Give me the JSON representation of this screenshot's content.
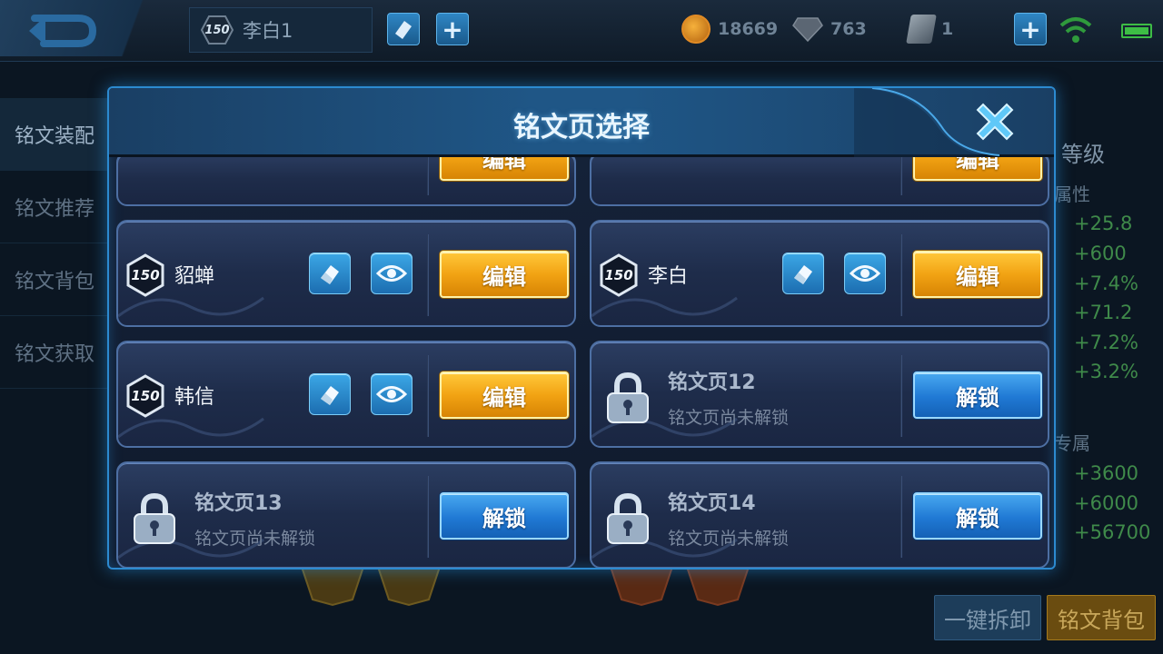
{
  "topbar": {
    "player_level": "150",
    "player_name": "李白1",
    "gold": "18669",
    "diamonds": "763",
    "cards": "1"
  },
  "left_nav": [
    {
      "label": "铭文装配",
      "active": true
    },
    {
      "label": "铭文推荐",
      "active": false
    },
    {
      "label": "铭文背包",
      "active": false
    },
    {
      "label": "铭文获取",
      "active": false
    }
  ],
  "right_panel": {
    "title": "等级",
    "section1": "属性",
    "values1": [
      "+25.8",
      "+600",
      "+7.4%",
      "+71.2",
      "+7.2%",
      "+3.2%"
    ],
    "section2": "专属",
    "values2": [
      "+3600",
      "+6000",
      "+56700"
    ]
  },
  "bottom": {
    "unequip_all": "一键拆卸",
    "rune_bag": "铭文背包"
  },
  "modal": {
    "title": "铭文页选择",
    "edit_label": "编辑",
    "unlock_label": "解锁",
    "pages": [
      {
        "type": "hero",
        "level": "150",
        "name": "貂蝉"
      },
      {
        "type": "hero",
        "level": "150",
        "name": "李白"
      },
      {
        "type": "hero",
        "level": "150",
        "name": "韩信"
      },
      {
        "type": "locked",
        "title": "铭文页12",
        "subtitle": "铭文页尚未解锁"
      },
      {
        "type": "locked",
        "title": "铭文页13",
        "subtitle": "铭文页尚未解锁"
      },
      {
        "type": "locked",
        "title": "铭文页14",
        "subtitle": "铭文页尚未解锁"
      }
    ]
  },
  "colors": {
    "accent_blue": "#2c8ad0",
    "edit_gold": "#f2a313",
    "unlock_blue": "#2079d4"
  },
  "icons": {
    "back": "back-arrow-icon",
    "edit": "eraser-icon",
    "preview": "eye-icon",
    "close": "close-x-icon",
    "lock": "padlock-icon"
  }
}
